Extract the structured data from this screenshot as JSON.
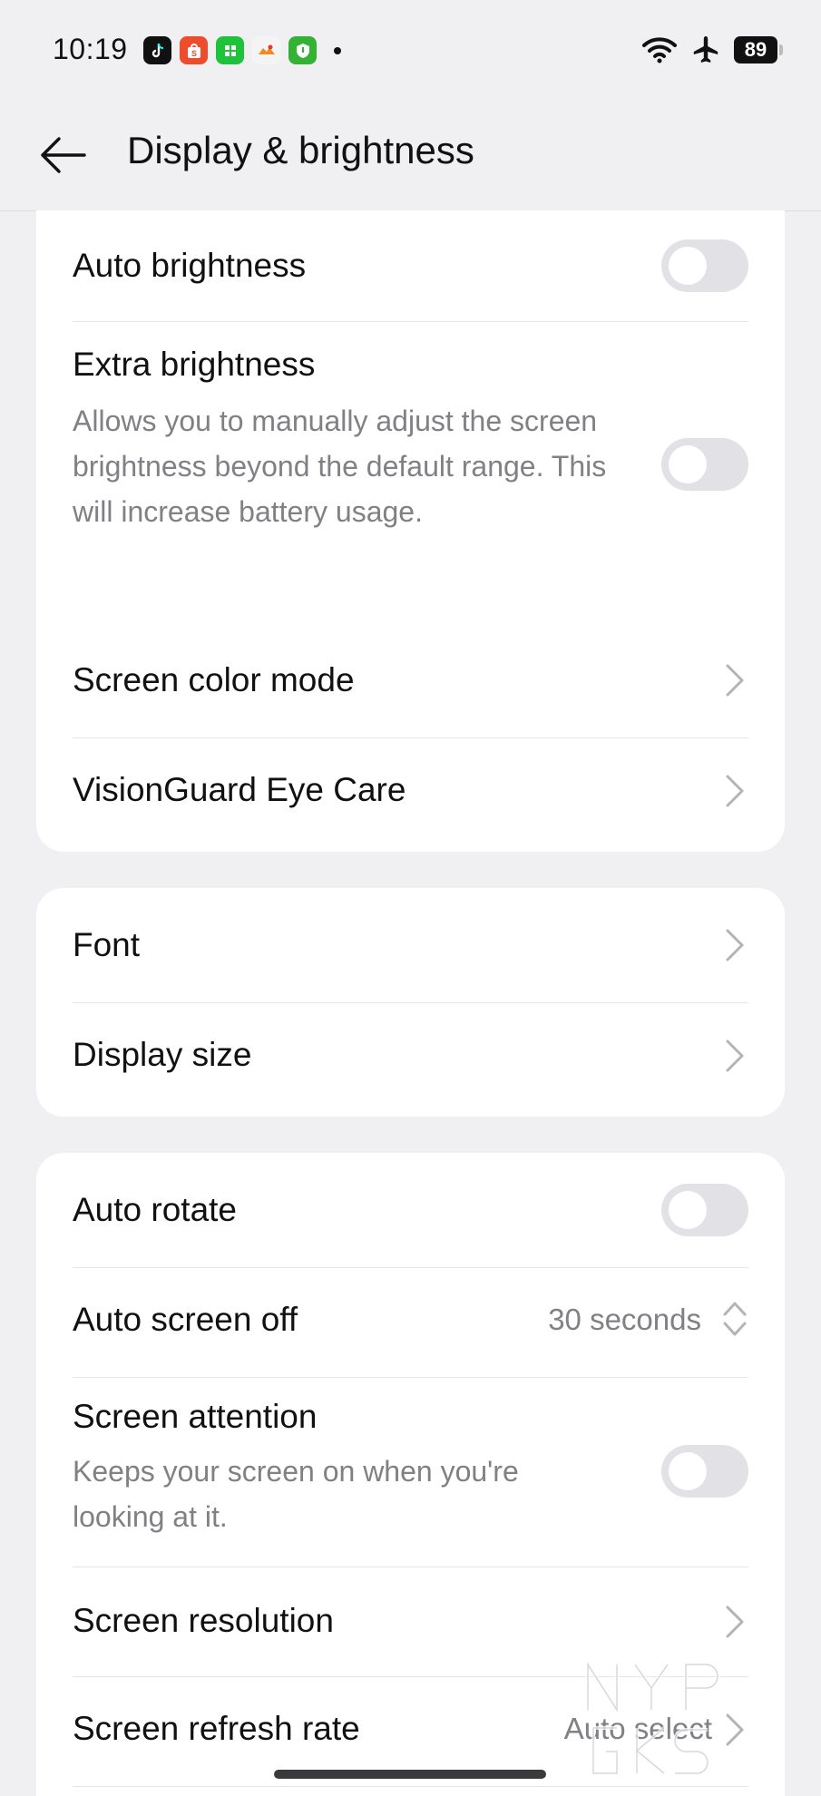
{
  "status_bar": {
    "time": "10:19",
    "battery": "89",
    "notification_icons": [
      "tiktok-icon",
      "shopee-icon",
      "grid-app-icon",
      "game-icon",
      "shield-app-icon"
    ],
    "system_icons": [
      "wifi-icon",
      "airplane-icon",
      "battery-icon"
    ]
  },
  "header": {
    "title": "Display & brightness"
  },
  "brightness_card": {
    "auto_brightness": {
      "label": "Auto brightness",
      "on": false
    },
    "extra_brightness": {
      "label": "Extra brightness",
      "description": "Allows you to manually adjust the screen brightness beyond the default range. This will increase battery usage.",
      "on": false
    }
  },
  "color_card": {
    "screen_color_mode": "Screen color mode",
    "visionguard": "VisionGuard Eye Care"
  },
  "font_card": {
    "font": "Font",
    "display_size": "Display size"
  },
  "screen_card": {
    "auto_rotate": {
      "label": "Auto rotate",
      "on": false
    },
    "auto_screen_off": {
      "label": "Auto screen off",
      "value": "30 seconds"
    },
    "screen_attention": {
      "label": "Screen attention",
      "description": "Keeps your screen on when you're looking at it.",
      "on": false
    },
    "screen_resolution": "Screen resolution",
    "screen_refresh_rate": {
      "label": "Screen refresh rate",
      "value": "Auto select"
    }
  },
  "watermark": "NYPGKS",
  "colors": {
    "background": "#f0f0f3",
    "card": "#ffffff",
    "toggle_off": "#e2e2e6",
    "secondary_text": "#808085"
  }
}
